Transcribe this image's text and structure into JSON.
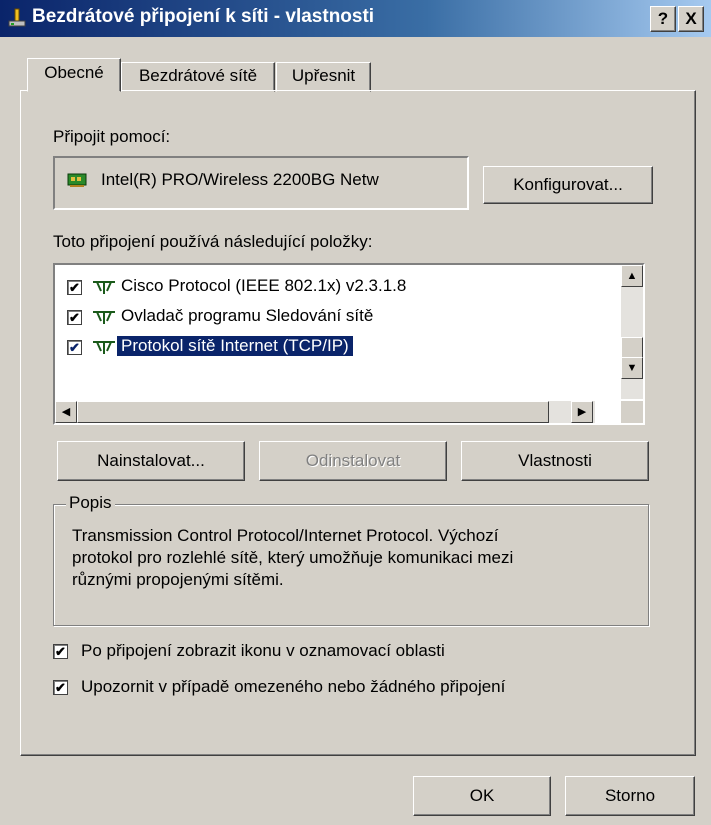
{
  "window": {
    "title": "Bezdrátové připojení k síti - vlastnosti",
    "help": "?",
    "close": "X"
  },
  "tabs": [
    {
      "label": "Obecné"
    },
    {
      "label": "Bezdrátové sítě"
    },
    {
      "label": "Upřesnit"
    }
  ],
  "connect_using": {
    "label": "Připojit pomocí:",
    "adapter": "Intel(R) PRO/Wireless 2200BG Netw",
    "configure_button": "Konfigurovat..."
  },
  "components": {
    "label": "Toto připojení používá následující položky:",
    "items": [
      {
        "label": "Cisco Protocol (IEEE 802.1x) v2.3.1.8",
        "checked": true
      },
      {
        "label": "Ovladač programu Sledování sítě",
        "checked": true
      },
      {
        "label": "Protokol sítě Internet (TCP/IP)",
        "checked": true,
        "selected": true
      }
    ]
  },
  "buttons": {
    "install": "Nainstalovat...",
    "uninstall": "Odinstalovat",
    "properties": "Vlastnosti"
  },
  "description": {
    "legend": "Popis",
    "lines": [
      "Transmission Control Protocol/Internet Protocol. Výchozí",
      "protokol pro rozlehlé sítě, který umožňuje komunikaci mezi",
      "různými propojenými sítěmi."
    ]
  },
  "options": [
    {
      "label": "Po připojení zobrazit ikonu v oznamovací oblasti",
      "checked": true
    },
    {
      "label": "Upozornit v případě omezeného nebo žádného připojení",
      "checked": true
    }
  ],
  "footer": {
    "ok": "OK",
    "cancel": "Storno"
  },
  "check_mark": "✔",
  "colors": {
    "titlebar": "#0a246a",
    "face": "#d4d0c8",
    "selection": "#0a246a"
  }
}
